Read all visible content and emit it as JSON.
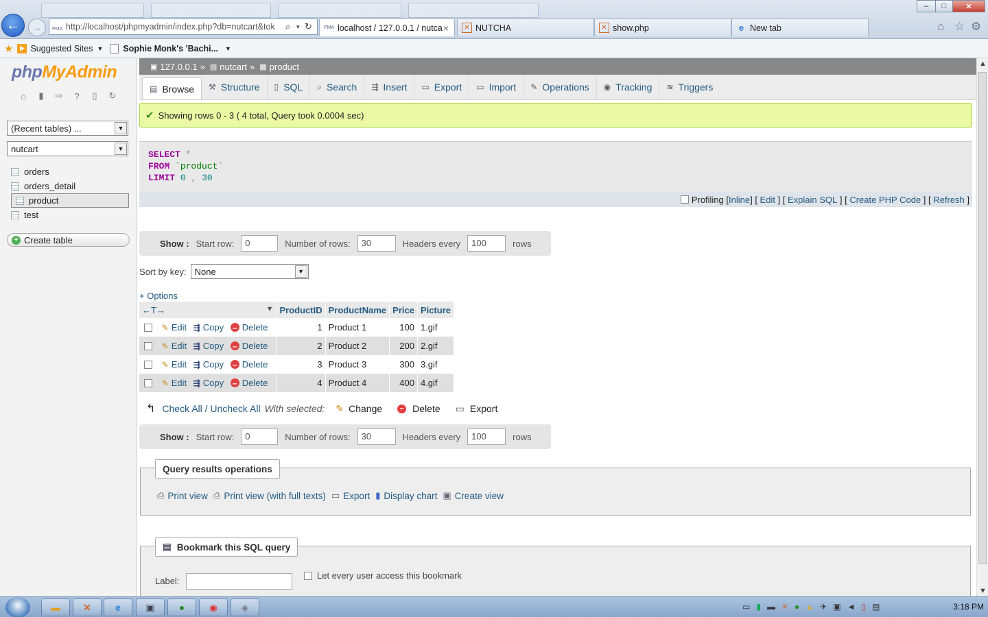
{
  "browser": {
    "address_url": "http://localhost/phpmyadmin/index.php?db=nutcart&tok",
    "address_favicon": "PMA",
    "tabs": [
      {
        "label": "localhost / 127.0.0.1 / nutca...",
        "close": "×",
        "active": true
      },
      {
        "label": "NUTCHA",
        "active": false
      },
      {
        "label": "show.php",
        "active": false
      },
      {
        "label": "New tab",
        "active": false
      }
    ],
    "favorites": [
      {
        "label": "Suggested Sites",
        "icon": "suggested-sites-icon"
      },
      {
        "label": "Sophie Monk's 'Bachi...",
        "icon": "page-icon"
      }
    ],
    "window_controls": {
      "minimize": "–",
      "maximize": "□",
      "close": "✕"
    }
  },
  "sidebar": {
    "logo_php": "php",
    "logo_myadmin": "MyAdmin",
    "recent_tables": "(Recent tables) ...",
    "database": "nutcart",
    "tables": [
      {
        "label": "orders",
        "selected": false
      },
      {
        "label": "orders_detail",
        "selected": false
      },
      {
        "label": "product",
        "selected": true
      },
      {
        "label": "test",
        "selected": false
      }
    ],
    "create_table": "Create table"
  },
  "breadcrumb": {
    "server": "127.0.0.1",
    "sep": "»",
    "database": "nutcart",
    "table": "product"
  },
  "menu_tabs": [
    {
      "label": "Browse",
      "icon": "browse-icon",
      "active": true
    },
    {
      "label": "Structure",
      "icon": "structure-icon"
    },
    {
      "label": "SQL",
      "icon": "sql-icon"
    },
    {
      "label": "Search",
      "icon": "search-icon"
    },
    {
      "label": "Insert",
      "icon": "insert-icon"
    },
    {
      "label": "Export",
      "icon": "export-icon"
    },
    {
      "label": "Import",
      "icon": "import-icon"
    },
    {
      "label": "Operations",
      "icon": "operations-icon"
    },
    {
      "label": "Tracking",
      "icon": "tracking-icon"
    },
    {
      "label": "Triggers",
      "icon": "triggers-icon"
    }
  ],
  "message": "Showing rows 0 - 3 ( 4 total, Query took 0.0004 sec)",
  "sql": {
    "select": "SELECT",
    "star": "*",
    "from": "FROM",
    "table": "`product`",
    "limit": "LIMIT",
    "offset": "0",
    "comma": ",",
    "count": "30"
  },
  "sql_links": {
    "profiling": "Profiling",
    "inline": "Inline",
    "edit": "Edit",
    "explain": "Explain SQL",
    "php": "Create PHP Code",
    "refresh": "Refresh"
  },
  "nav_form": {
    "show": "Show :",
    "start_row_label": "Start row:",
    "start_row": "0",
    "rows_label": "Number of rows:",
    "rows": "30",
    "headers_label": "Headers every",
    "headers": "100",
    "rows_suffix": "rows"
  },
  "sort": {
    "label": "Sort by key:",
    "value": "None"
  },
  "options_label": "+ Options",
  "column_nav": "←T→",
  "columns": [
    "ProductID",
    "ProductName",
    "Price",
    "Picture"
  ],
  "row_actions": {
    "edit": "Edit",
    "copy": "Copy",
    "delete": "Delete"
  },
  "rows": [
    {
      "id": "1",
      "name": "Product 1",
      "price": "100",
      "picture": "1.gif"
    },
    {
      "id": "2",
      "name": "Product 2",
      "price": "200",
      "picture": "2.gif"
    },
    {
      "id": "3",
      "name": "Product 3",
      "price": "300",
      "picture": "3.gif"
    },
    {
      "id": "4",
      "name": "Product 4",
      "price": "400",
      "picture": "4.gif"
    }
  ],
  "bulk": {
    "check_all": "Check All / Uncheck All",
    "with_selected": "With selected:",
    "change": "Change",
    "delete": "Delete",
    "export": "Export"
  },
  "query_results_ops": {
    "legend": "Query results operations",
    "print_view": "Print view",
    "print_full": "Print view (with full texts)",
    "export": "Export",
    "display_chart": "Display chart",
    "create_view": "Create view"
  },
  "bookmark": {
    "legend": "Bookmark this SQL query",
    "label": "Label:",
    "let_every_user": "Let every user access this bookmark"
  },
  "taskbar": {
    "time": "3:18 PM"
  },
  "colors": {
    "accent": "#235a81",
    "success_bg": "#ebf8a4",
    "crumb_bg": "#888888",
    "keyword": "#990099"
  }
}
